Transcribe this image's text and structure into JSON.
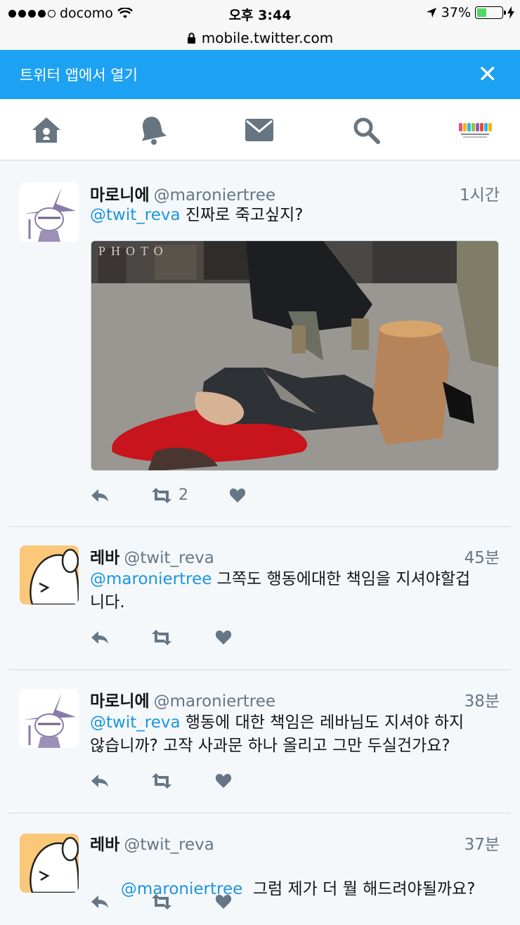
{
  "status_bar": {
    "carrier": "docomo",
    "time": "오후 3:44",
    "battery_pct": "37%",
    "battery_level": 0.37,
    "battery_color": "#4cd964"
  },
  "url": "mobile.twitter.com",
  "banner": {
    "text": "트위터 앱에서 열기",
    "color": "#1da1f2"
  },
  "nav": {
    "items": [
      "home-icon",
      "notifications-bell-icon",
      "messages-envelope-icon",
      "search-icon",
      "profile-avatar"
    ]
  },
  "tweets": [
    {
      "name": "마로니에",
      "handle": "@maroniertree",
      "time": "1시간",
      "mention": "@twit_reva",
      "text": " 진짜로 죽고싶지?",
      "retweets": "2",
      "has_media": true
    },
    {
      "name": "레바",
      "handle": "@twit_reva",
      "time": "45분",
      "mention": "@maroniertree",
      "text_line1": " 그쪽도 행동에대한 책임을 지셔야할겁",
      "text_line2": "니다."
    },
    {
      "name": "마로니에",
      "handle": "@maroniertree",
      "time": "38분",
      "mention": "@twit_reva",
      "text_line1": " 행동에 대한 책임은 레바님도 지셔야 하지",
      "text_line2": "않습니까? 고작 사과문 하나 올리고 그만 두실건가요?"
    },
    {
      "name": "레바",
      "handle": "@twit_reva",
      "time": "37분",
      "mention": "@maroniertree",
      "text": "  그럼 제가 더 뭘 해드려야될까요?"
    }
  ],
  "colors": {
    "link": "#1b95e0",
    "muted": "#657786",
    "icon": "#66757f"
  }
}
